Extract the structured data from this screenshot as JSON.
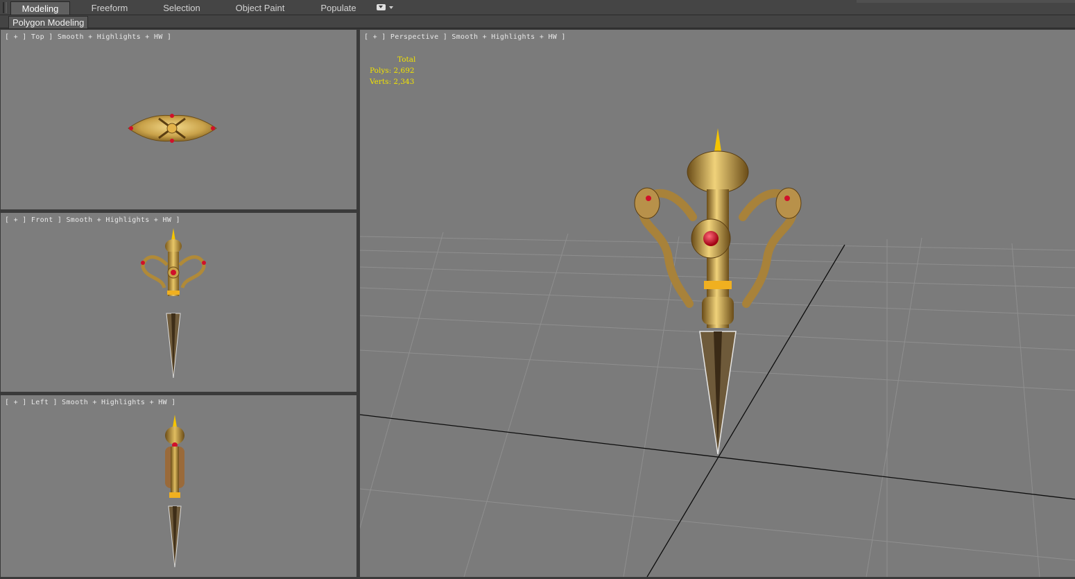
{
  "ribbon": {
    "tabs": [
      {
        "label": "Modeling",
        "active": true
      },
      {
        "label": "Freeform"
      },
      {
        "label": "Selection"
      },
      {
        "label": "Object Paint"
      },
      {
        "label": "Populate"
      }
    ],
    "panel_label": "Polygon Modeling"
  },
  "viewports": {
    "top": {
      "label": "[ + ] Top ] Smooth + Highlights + HW ]"
    },
    "front": {
      "label": "[ + ] Front ] Smooth + Highlights + HW ]"
    },
    "left": {
      "label": "[ + ] Left ] Smooth + Highlights + HW ]"
    },
    "perspective": {
      "label": "[ + ] Perspective ] Smooth + Highlights + HW ]"
    }
  },
  "stats": {
    "header": "Total",
    "polys": "Polys: 2,692",
    "verts": "Verts: 2,343"
  },
  "colors": {
    "viewport_bg": "#7d7d7d",
    "stats_text": "#f2e300",
    "gold": "#c8a040",
    "gem": "#d0102a"
  },
  "icons": {
    "tab_dropdown": "dropdown-icon"
  }
}
